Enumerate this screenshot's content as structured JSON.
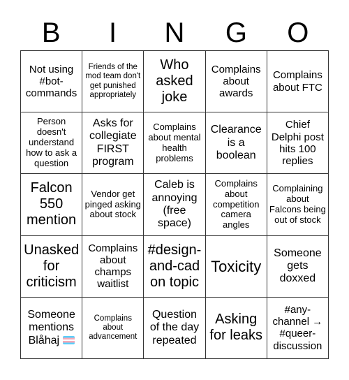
{
  "header": [
    "B",
    "I",
    "N",
    "G",
    "O"
  ],
  "cells": [
    "Not using #bot-commands",
    "Friends of the mod team don't get punished appropriately",
    "Who asked joke",
    "Complains about awards",
    "Complains about FTC",
    "Person doesn't understand how to ask a question",
    "Asks for collegiate FIRST program",
    "Complains about mental health problems",
    "Clearance is a boolean",
    "Chief Delphi post hits 100 replies",
    "Falcon 550 mention",
    "Vendor get pinged asking about stock",
    "Caleb is annoying (free space)",
    "Complains about competition camera angles",
    "Complaining about Falcons being out of stock",
    "Unasked for criticism",
    "Complains about champs waitlist",
    "#design-and-cad on topic",
    "Toxicity",
    "Someone gets doxxed",
    "Someone mentions Blåhaj",
    "Complains about advancement",
    "Question of the day repeated",
    "Asking for leaks",
    "#any-channel → #queer-discussion"
  ],
  "icons": {
    "cell_20": "transgender-flag-icon"
  }
}
